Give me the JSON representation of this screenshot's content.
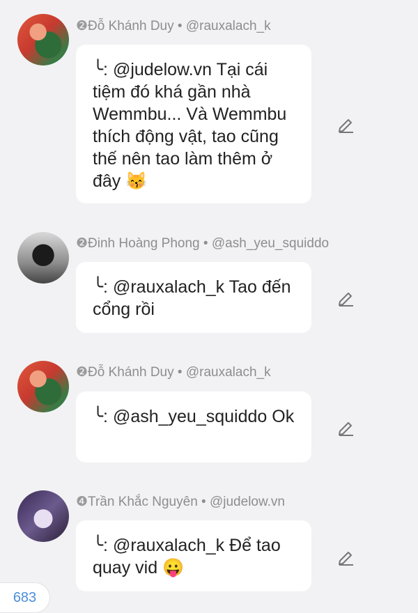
{
  "messages": [
    {
      "badge": "❷",
      "name": "Đỗ Khánh Duy",
      "sep": " • ",
      "handle": "@rauxalach_k",
      "text": "╰: @judelow.vn Tại cái tiệm đó khá gần nhà Wemmbu... Và Wemmbu thích động vật, tao cũng thế nên tao làm thêm ở đây 😽"
    },
    {
      "badge": "❷",
      "name": "Đinh Hoàng Phong",
      "sep": " • ",
      "handle": "@ash_yeu_squiddo",
      "text": "╰: @rauxalach_k Tao đến cổng rồi"
    },
    {
      "badge": "❷",
      "name": "Đỗ Khánh Duy",
      "sep": " • ",
      "handle": "@rauxalach_k",
      "text": "╰: @ash_yeu_squiddo Ok"
    },
    {
      "badge": "❹",
      "name": "Trần Khắc Nguyên",
      "sep": " • ",
      "handle": "@judelow.vn",
      "text": "╰: @rauxalach_k Để tao quay vid 😛"
    }
  ],
  "counter": "683",
  "icons": {
    "edit": "pencil-icon"
  }
}
